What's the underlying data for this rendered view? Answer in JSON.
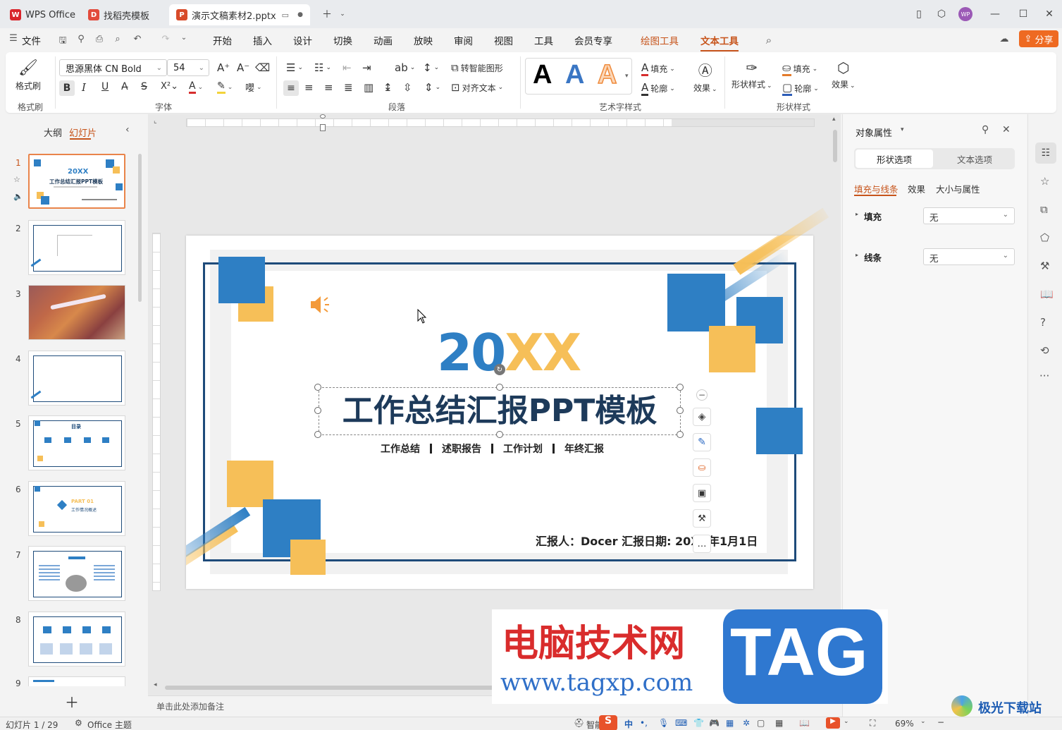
{
  "tabs": {
    "wps": "WPS Office",
    "template": "找稻壳模板",
    "file": "演示文稿素材2.pptx"
  },
  "menu": {
    "file": "文件",
    "items": [
      "开始",
      "插入",
      "设计",
      "切换",
      "动画",
      "放映",
      "审阅",
      "视图",
      "工具",
      "会员专享",
      "绘图工具",
      "文本工具"
    ],
    "share": "分享"
  },
  "ribbon": {
    "format_painter": "格式刷",
    "group_format": "格式刷",
    "font_name": "思源黑体 CN Bold",
    "font_size": "54",
    "group_font": "字体",
    "smart_shape": "转智能图形",
    "align_text": "对齐文本",
    "group_paragraph": "段落",
    "fill": "填充",
    "outline": "轮廓",
    "effect": "效果",
    "group_art": "艺术字样式",
    "shape_style": "形状样式",
    "shape_fill": "填充",
    "shape_outline": "轮廓",
    "shape_effect": "效果",
    "group_shape": "形状样式"
  },
  "left_panel": {
    "outline_tab": "大纲",
    "slides_tab": "幻灯片",
    "slide_numbers": [
      "1",
      "2",
      "3",
      "4",
      "5",
      "6",
      "7",
      "8",
      "9"
    ]
  },
  "slide": {
    "year_part1": "20",
    "year_part2": "XX",
    "title": "工作总结汇报PPT模板",
    "subtitle_items": [
      "工作总结",
      "述职报告",
      "工作计划",
      "年终汇报"
    ],
    "reporter": "汇报人：Docer  汇报日期: 20XX年1月1日"
  },
  "thumb_text": {
    "t1_year": "20XX",
    "t1_title": "工作总结汇报PPT模板",
    "t5_title": "目录",
    "t6_part": "PART 01",
    "t6_sub": "工作情况概述"
  },
  "right_panel": {
    "title": "对象属性",
    "tab_shape": "形状选项",
    "tab_text": "文本选项",
    "sub_fill_line": "填充与线条",
    "sub_effect": "效果",
    "sub_size": "大小与属性",
    "fill_label": "填充",
    "fill_value": "无",
    "line_label": "线条",
    "line_value": "无"
  },
  "notes_placeholder": "单击此处添加备注",
  "status": {
    "slide_count": "幻灯片 1 / 29",
    "theme": "Office 主题",
    "smart": "智能",
    "zoom": "69%"
  },
  "watermark": {
    "cn": "电脑技术网",
    "url": "www.tagxp.com",
    "tag": "TAG",
    "site": "极光下载站"
  },
  "colors": {
    "accent": "#c7541b",
    "blue": "#2e7fc4",
    "yellow": "#f6bf58",
    "navy": "#1e4b7a"
  }
}
